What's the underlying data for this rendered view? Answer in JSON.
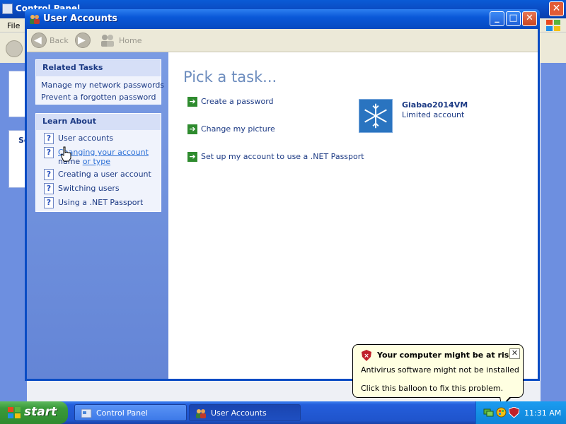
{
  "background_window": {
    "title": "Control Panel",
    "menu_file": "File",
    "side_text": "Se"
  },
  "window": {
    "title": "User Accounts",
    "min_glyph": "_",
    "max_glyph": "□",
    "close_glyph": "✕"
  },
  "toolbar": {
    "back_label": "Back",
    "home_label": "Home"
  },
  "related_tasks": {
    "heading": "Related Tasks",
    "items": [
      "Manage my network passwords",
      "Prevent a forgotten password"
    ]
  },
  "learn_about": {
    "heading": "Learn About",
    "items": [
      {
        "label": "User accounts"
      },
      {
        "label_line1": "Changing your account",
        "label_line2_a": "name",
        "label_line2_b": "or type"
      },
      {
        "label": "Creating a user account"
      },
      {
        "label": "Switching users"
      },
      {
        "label": "Using a .NET Passport"
      }
    ],
    "icon_glyph": "?"
  },
  "main": {
    "title": "Pick a task...",
    "tasks": [
      "Create a password",
      "Change my picture",
      "Set up my account to use a .NET Passport"
    ],
    "arrow_glyph": "➔"
  },
  "account": {
    "name": "Giabao2014VM",
    "type": "Limited account"
  },
  "balloon": {
    "title": "Your computer might be at risk",
    "line1": "Antivirus software might not be installed",
    "line2": "Click this balloon to fix this problem.",
    "close_glyph": "✕"
  },
  "taskbar": {
    "start_label": "start",
    "buttons": [
      "Control Panel",
      "User Accounts"
    ],
    "clock": "11:31 AM"
  },
  "colors": {
    "title_blue": "#0a58d8",
    "sidebar_blue": "#6d8fe0",
    "link_blue": "#1c3a84",
    "pick_title": "#6d8dbe",
    "start_green": "#3a9a3a",
    "balloon_bg": "#ffffe1"
  }
}
